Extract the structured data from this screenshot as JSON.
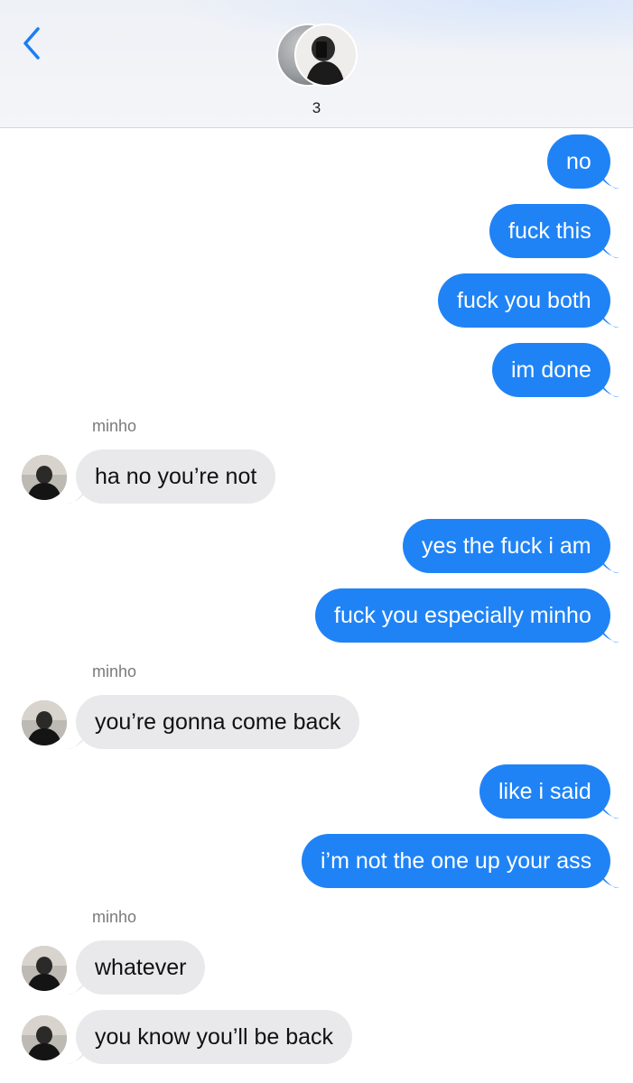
{
  "header": {
    "participant_count": "3",
    "back_icon": "chevron-left-icon"
  },
  "colors": {
    "sent_bubble": "#1f83f6",
    "received_bubble": "#e9e9eb",
    "accent": "#1a7ef5"
  },
  "messages": [
    {
      "direction": "sent",
      "text": "no"
    },
    {
      "direction": "sent",
      "text": "fuck this"
    },
    {
      "direction": "sent",
      "text": "fuck you both"
    },
    {
      "direction": "sent",
      "text": "im done"
    },
    {
      "direction": "received",
      "sender": "minho",
      "text": "ha no you’re not"
    },
    {
      "direction": "sent",
      "text": "yes the fuck i am"
    },
    {
      "direction": "sent",
      "text": "fuck you especially minho"
    },
    {
      "direction": "received",
      "sender": "minho",
      "text": "you’re gonna come back"
    },
    {
      "direction": "sent",
      "text": "like i said"
    },
    {
      "direction": "sent",
      "text": "i’m not the one up your ass"
    },
    {
      "direction": "received",
      "sender": "minho",
      "text": "whatever"
    },
    {
      "direction": "received",
      "text": "you know you’ll be back"
    }
  ]
}
